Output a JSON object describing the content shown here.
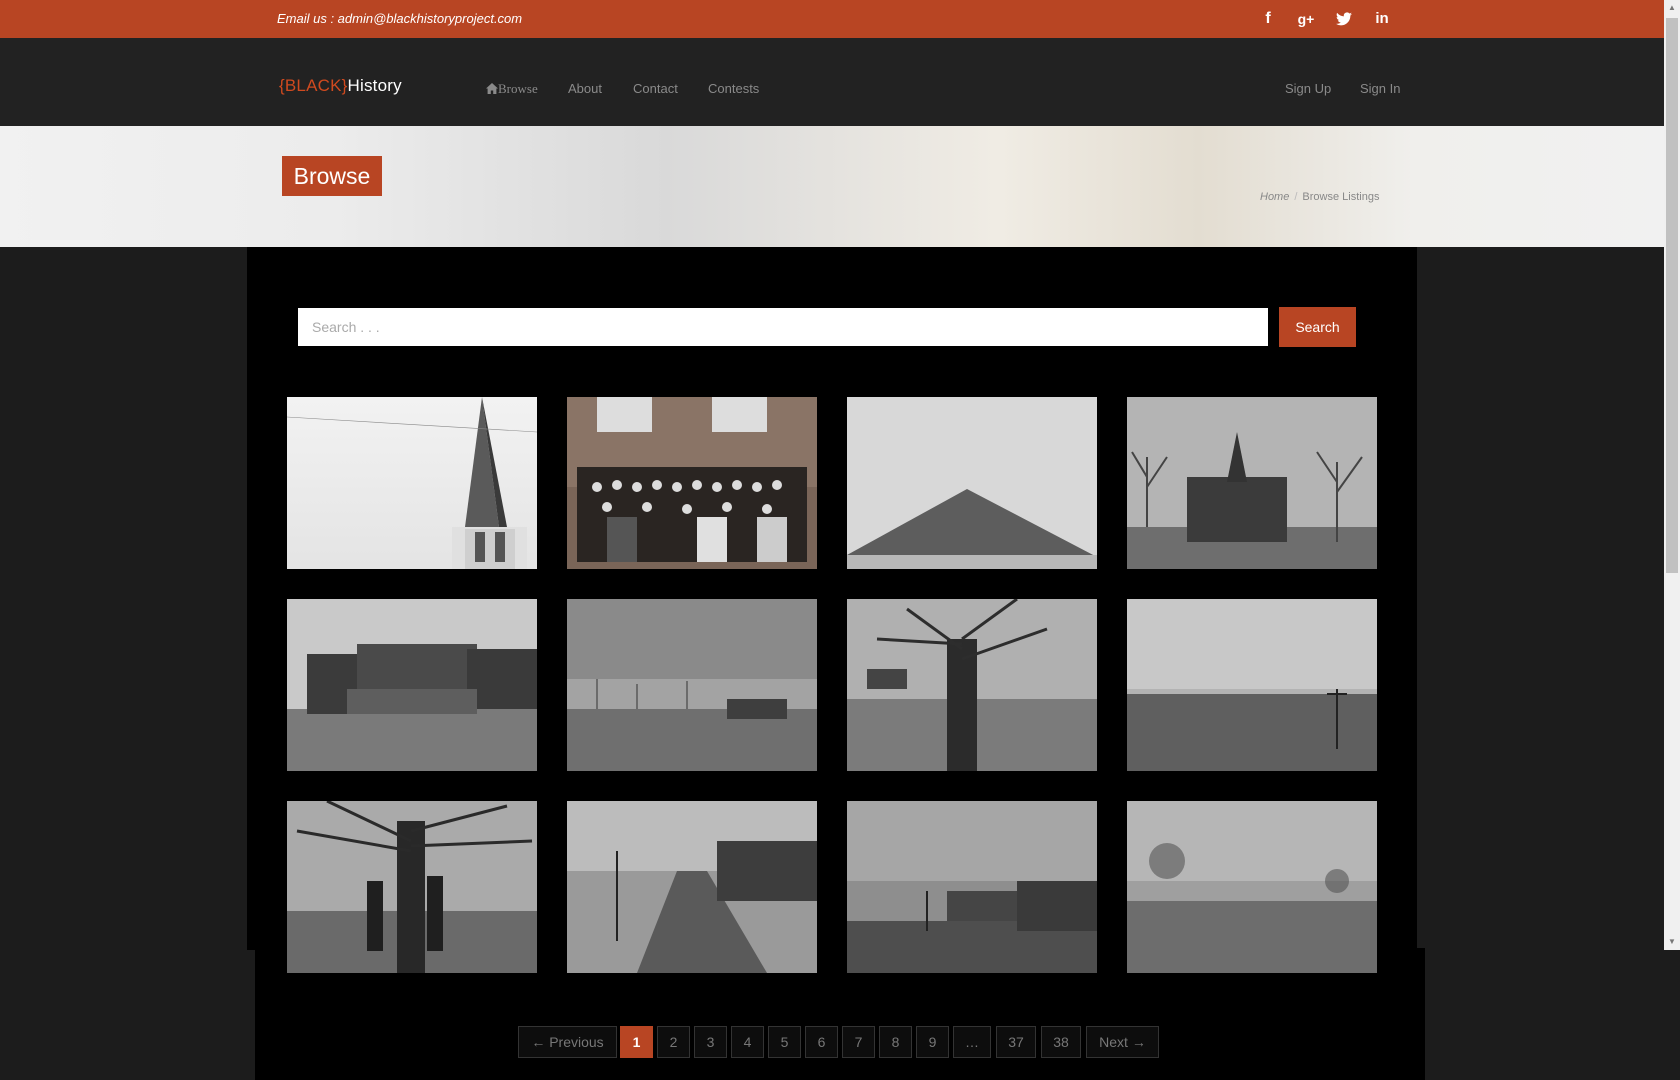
{
  "topbar": {
    "email": "Email us : admin@blackhistoryproject.com",
    "social": {
      "facebook": "f",
      "google": "g+",
      "twitter": "t",
      "linkedin": "in"
    }
  },
  "nav": {
    "logo_brand": "{BLACK}",
    "logo_text": "History",
    "browse": "Browse",
    "about": "About",
    "contact": "Contact",
    "contests": "Contests",
    "signup": "Sign Up",
    "signin": "Sign In"
  },
  "banner": {
    "title": "Browse",
    "breadcrumb_home": "Home",
    "breadcrumb_sep": "/",
    "breadcrumb_current": "Browse Listings"
  },
  "search": {
    "placeholder": "Search . . .",
    "button": "Search"
  },
  "pagination": {
    "previous": "← Previous",
    "pages": [
      "1",
      "2",
      "3",
      "4",
      "5",
      "6",
      "7",
      "8",
      "9",
      "…",
      "37",
      "38"
    ],
    "next": "Next →",
    "active": "1"
  },
  "colors": {
    "accent": "#b84523",
    "nav_bg": "#222222",
    "content_bg": "#000000"
  }
}
